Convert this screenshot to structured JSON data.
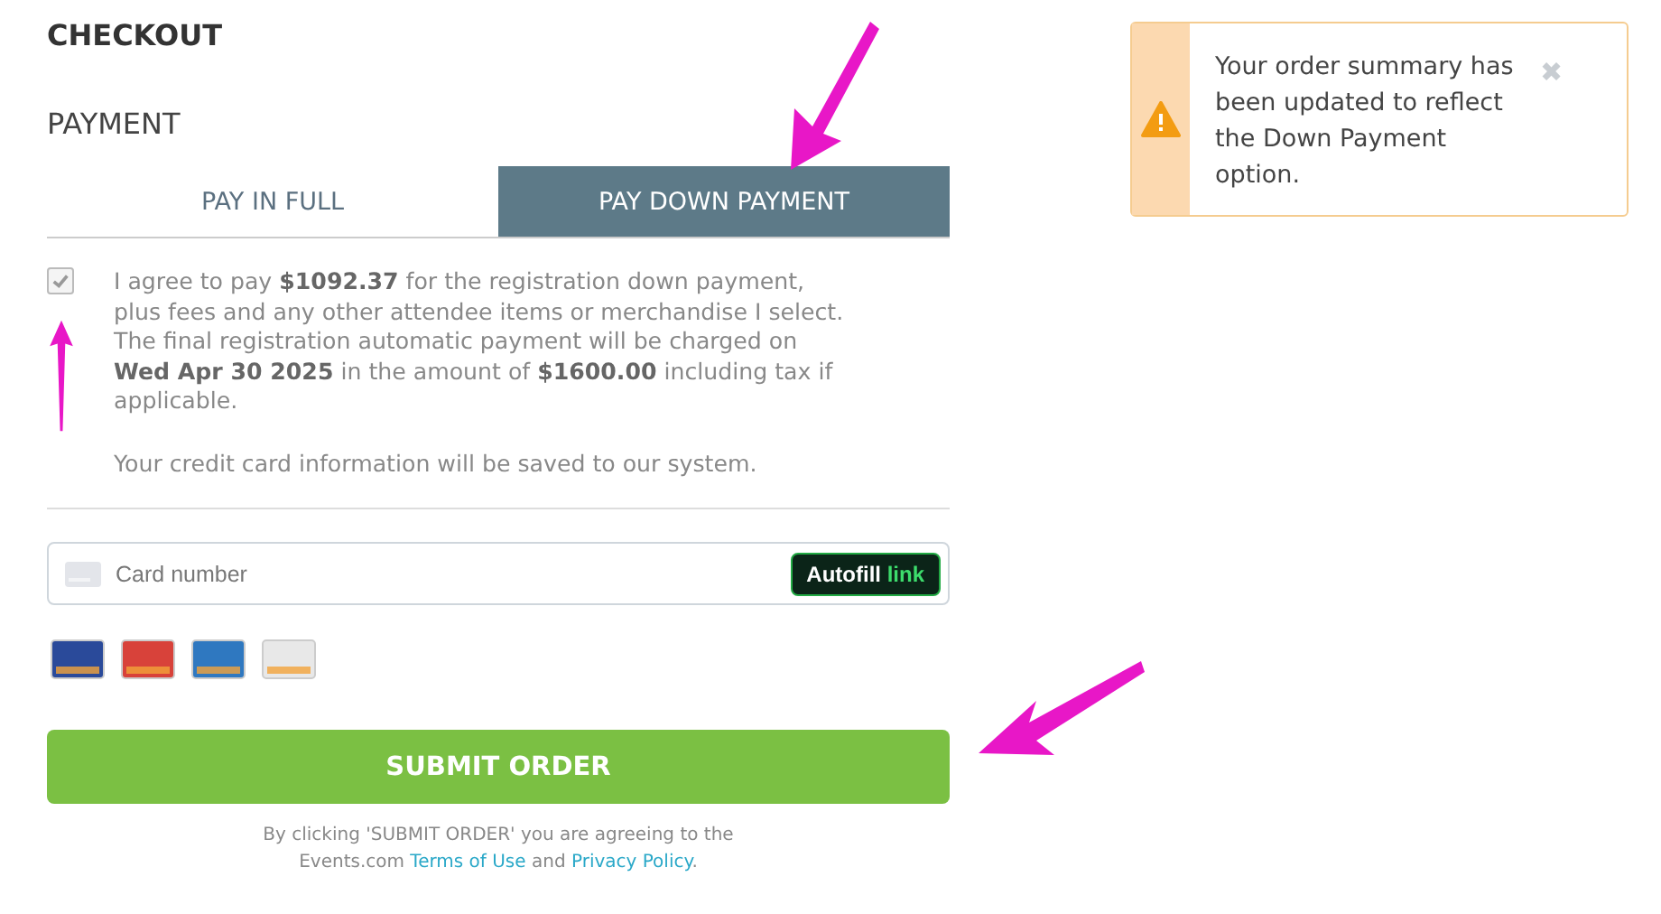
{
  "heading": "CHECKOUT",
  "section": "PAYMENT",
  "tabs": [
    {
      "label": "PAY IN FULL",
      "selected": false
    },
    {
      "label": "PAY DOWN PAYMENT",
      "selected": true
    }
  ],
  "agreement": {
    "checked": true,
    "text": "I agree to pay **$1092.37** for the registration down payment, plus fees and any other attendee items or merchandise I select. The final registration automatic payment will be charged on **Wed Apr 30 2025** in the amount of **$1600.00** including tax if applicable.",
    "note": "Your credit card information will be saved to our system."
  },
  "card_field": {
    "placeholder": "Card number",
    "autofill": "Autofill",
    "autofill_brand": "link"
  },
  "card_logos": [
    {
      "color": "#2a4a9a"
    },
    {
      "color": "#d8423a"
    },
    {
      "color": "#2f78c0"
    },
    {
      "color": "#e8e8e8"
    }
  ],
  "submit": "SUBMIT ORDER",
  "footer": {
    "before": "By clicking 'SUBMIT ORDER' you are agreeing to the Events.com",
    "terms_link": "Terms of Use",
    "middle": "and",
    "privacy_link": "Privacy Policy",
    "after": "."
  },
  "alert": {
    "message": "Your order summary has been updated to reflect the Down Payment option.",
    "close": "✖"
  }
}
